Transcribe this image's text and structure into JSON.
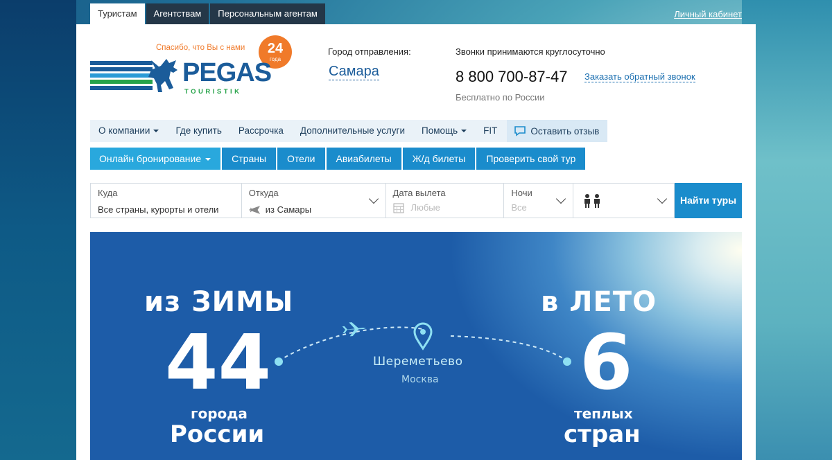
{
  "top_tabs": [
    {
      "label": "Туристам",
      "active": true
    },
    {
      "label": "Агентствам",
      "active": false
    },
    {
      "label": "Персональным агентам",
      "active": false
    }
  ],
  "cabinet_link": "Личный кабинет",
  "header": {
    "slogan": "Спасибо, что Вы с нами",
    "badge_number": "24",
    "badge_sub": "года",
    "logo_word": "PEGAS",
    "logo_sub": "TOURISTIK",
    "departure_label": "Город отправления:",
    "departure_city": "Самара",
    "calls_label": "Звонки принимаются круглосуточно",
    "phone": "8 800 700-87-47",
    "callback_link": "Заказать обратный звонок",
    "free_label": "Бесплатно по России"
  },
  "menu": {
    "items": [
      {
        "label": "О компании",
        "dropdown": true
      },
      {
        "label": "Где купить",
        "dropdown": false
      },
      {
        "label": "Рассрочка",
        "dropdown": false
      },
      {
        "label": "Дополнительные услуги",
        "dropdown": false
      },
      {
        "label": "Помощь",
        "dropdown": true
      },
      {
        "label": "FIT",
        "dropdown": false
      }
    ],
    "feedback_label": "Оставить отзыв"
  },
  "nav": {
    "items": [
      {
        "label": "Онлайн бронирование",
        "dropdown": true
      },
      {
        "label": "Страны"
      },
      {
        "label": "Отели"
      },
      {
        "label": "Авиабилеты"
      },
      {
        "label": "Ж/д билеты"
      },
      {
        "label": "Проверить свой тур"
      }
    ]
  },
  "search": {
    "where_label": "Куда",
    "where_value": "Все страны, курорты и отели",
    "from_label": "Откуда",
    "from_value": "из Самары",
    "date_label": "Дата вылета",
    "date_value": "Любые",
    "nights_label": "Ночи",
    "nights_value": "Все",
    "button": "Найти туры"
  },
  "banner": {
    "left_top": "из ЗИМЫ",
    "left_number": "44",
    "left_small": "города",
    "left_big": "России",
    "right_top": "в ЛЕТО",
    "right_number": "6",
    "right_small": "теплых",
    "right_big": "стран",
    "airport": "Шереметьево",
    "city": "Москва"
  },
  "colors": {
    "brand_blue": "#1b5c9a",
    "accent_orange": "#f07a2a",
    "nav_blue": "#1a8ccc",
    "logo_green": "#27a34a"
  }
}
